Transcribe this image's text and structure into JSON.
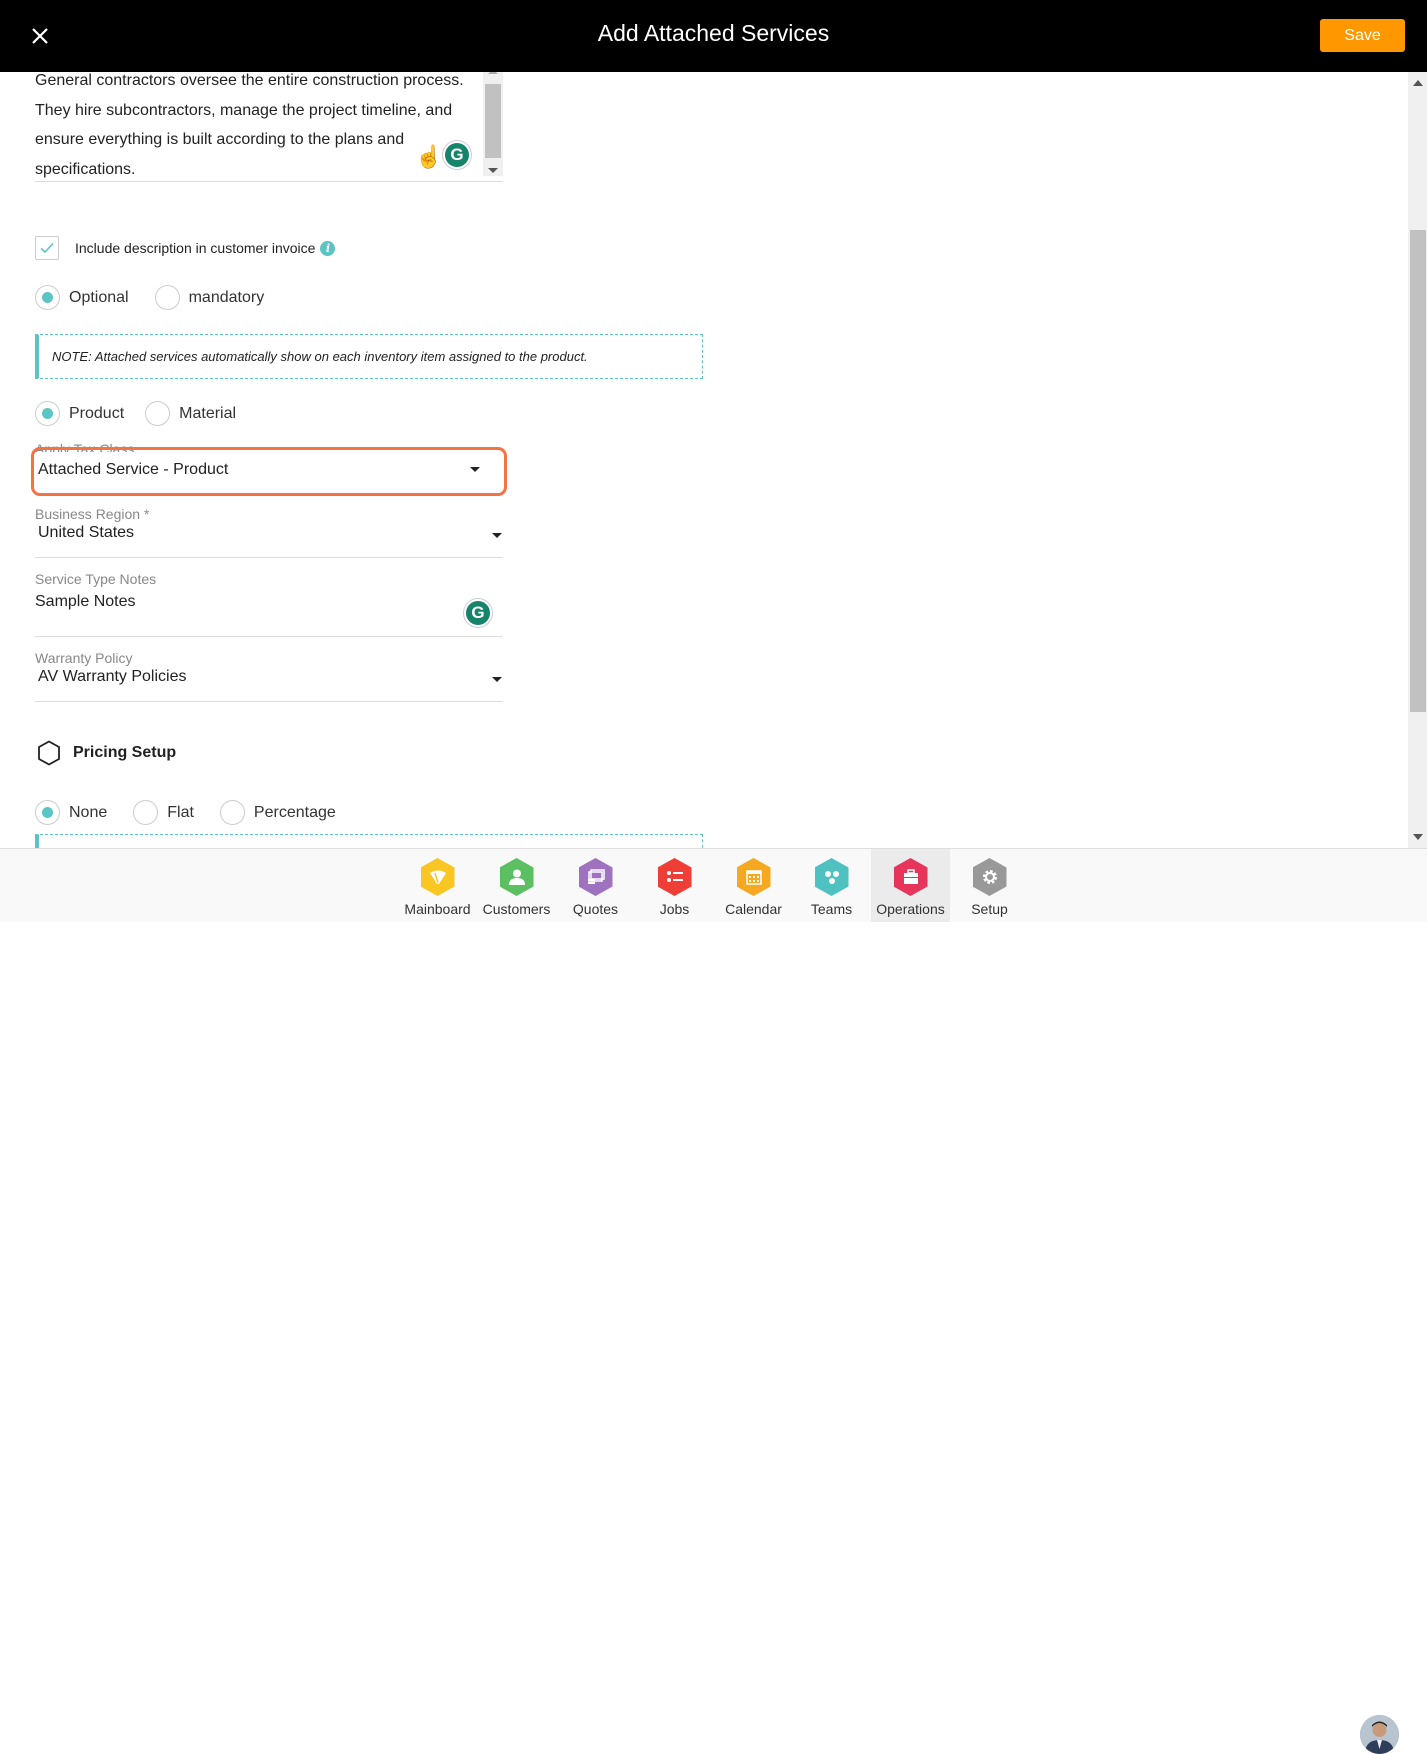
{
  "header": {
    "title": "Add Attached Services",
    "save_label": "Save",
    "close_icon": "close-icon"
  },
  "description": {
    "text": "General contractors oversee the entire construction process. They hire subcontractors, manage the project timeline, and ensure everything is built according to the plans and specifications."
  },
  "include_description": {
    "label": "Include description in customer invoice",
    "checked": true
  },
  "requirement": {
    "options": [
      {
        "label": "Optional",
        "selected": true
      },
      {
        "label": "mandatory",
        "selected": false
      }
    ]
  },
  "note": {
    "text": "NOTE: Attached services automatically show on each inventory item assigned to the product."
  },
  "item_type": {
    "options": [
      {
        "label": "Product",
        "selected": true
      },
      {
        "label": "Material",
        "selected": false
      }
    ]
  },
  "fields": {
    "tax_class": {
      "label": "Apply Tax Class",
      "value": "Attached Service - Product"
    },
    "business_region": {
      "label": "Business Region *",
      "value": "United States"
    },
    "service_notes": {
      "label": "Service Type Notes",
      "value": "Sample Notes"
    },
    "warranty_policy": {
      "label": "Warranty Policy",
      "value": "AV Warranty Policies"
    }
  },
  "pricing": {
    "title": "Pricing Setup",
    "options": [
      {
        "label": "None",
        "selected": true
      },
      {
        "label": "Flat",
        "selected": false
      },
      {
        "label": "Percentage",
        "selected": false
      }
    ]
  },
  "nav": {
    "items": [
      {
        "label": "Mainboard",
        "icon": "mainboard-icon",
        "color": "#f9c623"
      },
      {
        "label": "Customers",
        "icon": "customer-icon",
        "color": "#5cbf62"
      },
      {
        "label": "Quotes",
        "icon": "quotes-icon",
        "color": "#9e72bf"
      },
      {
        "label": "Jobs",
        "icon": "jobs-icon",
        "color": "#ef3e36"
      },
      {
        "label": "Calendar",
        "icon": "calendar-icon",
        "color": "#f6a821"
      },
      {
        "label": "Teams",
        "icon": "teams-icon",
        "color": "#4fc1c1"
      },
      {
        "label": "Operations",
        "icon": "operations-icon",
        "color": "#e6345a",
        "active": true
      },
      {
        "label": "Setup",
        "icon": "gear-icon",
        "color": "#999999"
      }
    ]
  },
  "colors": {
    "accent": "#5bc4c4",
    "save": "#ff9800",
    "highlight": "#f47345"
  }
}
